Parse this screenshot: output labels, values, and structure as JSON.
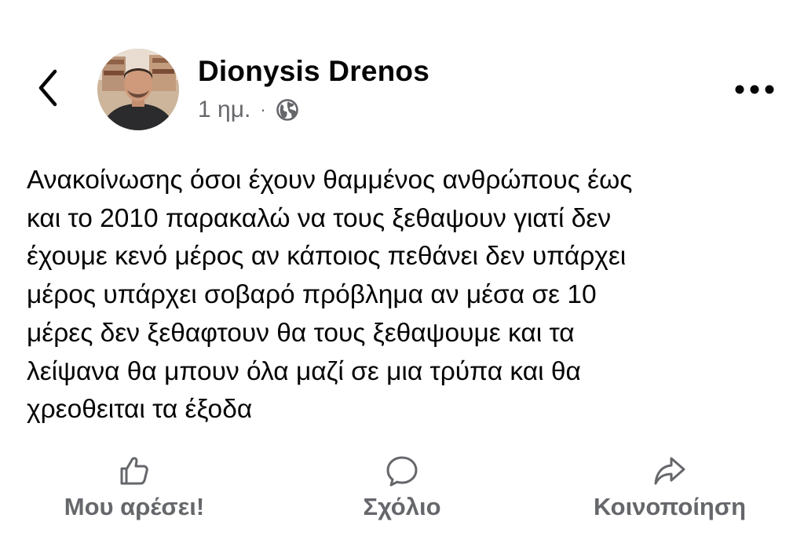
{
  "header": {
    "back_icon": "chevron-left-icon",
    "author_name": "Dionysis Drenos",
    "timestamp": "1 ημ.",
    "separator": "·",
    "privacy_icon": "globe-icon",
    "more_icon": "more-horizontal-icon"
  },
  "post": {
    "text": "Ανακοίνωσης όσοι έχουν  θαμμένος ανθρώπους έως\nκαι το 2010 παρακαλώ να τους ξεθαψουν γιατί δεν\nέχουμε κενό μέρος αν κάποιος πεθάνει δεν υπάρχει\nμέρος υπάρχει σοβαρό πρόβλημα αν μέσα σε 10\nμέρες δεν ξεθαφτουν θα τους ξεθαψουμε και τα\nλείψανα θα μπουν όλα μαζί σε μια τρύπα και θα\nχρεοθειται τα έξοδα"
  },
  "actions": {
    "like": {
      "label": "Μου αρέσει!",
      "icon": "thumbs-up-icon"
    },
    "comment": {
      "label": "Σχόλιο",
      "icon": "comment-bubble-icon"
    },
    "share": {
      "label": "Κοινοποίηση",
      "icon": "share-arrow-icon"
    }
  },
  "colors": {
    "text_primary": "#050505",
    "text_secondary": "#65676b",
    "background": "#ffffff"
  }
}
